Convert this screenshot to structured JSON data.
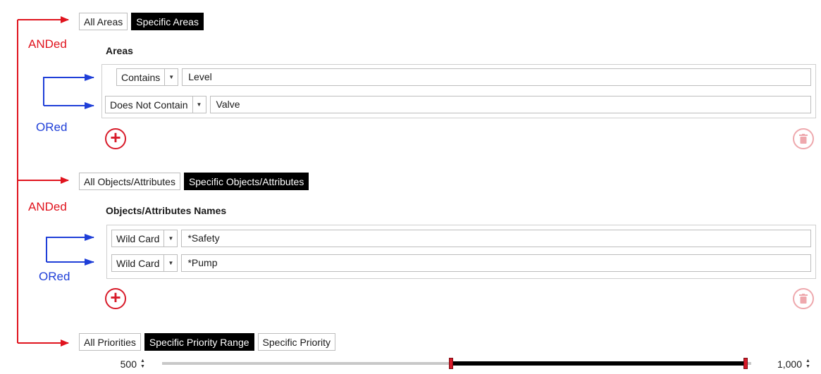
{
  "annotations": {
    "anded_1": "ANDed",
    "anded_2": "ANDed",
    "ored_1": "ORed",
    "ored_2": "ORed"
  },
  "areas": {
    "toggle": [
      {
        "label": "All Areas",
        "active": false
      },
      {
        "label": "Specific Areas",
        "active": true
      }
    ],
    "title": "Areas",
    "rows": [
      {
        "operator": "Contains",
        "value": "Level"
      },
      {
        "operator": "Does Not Contain",
        "value": "Valve"
      }
    ]
  },
  "objects": {
    "toggle": [
      {
        "label": "All Objects/Attributes",
        "active": false
      },
      {
        "label": "Specific Objects/Attributes",
        "active": true
      }
    ],
    "title": "Objects/Attributes Names",
    "rows": [
      {
        "operator": "Wild Card",
        "value": "*Safety"
      },
      {
        "operator": "Wild Card",
        "value": "*Pump"
      }
    ]
  },
  "priority": {
    "toggle": [
      {
        "label": "All Priorities",
        "active": false
      },
      {
        "label": "Specific Priority Range",
        "active": true
      },
      {
        "label": "Specific Priority",
        "active": false
      }
    ],
    "min_value": "500",
    "max_value": "1,000",
    "range_start_fraction": 0.49,
    "range_end_fraction": 0.99
  },
  "colors": {
    "and_arrow": "#e0141e",
    "or_arrow": "#1f3fd8",
    "add_button": "#d81b2a",
    "delete_button_disabled": "#eea8ad",
    "active_toggle": "#000000"
  },
  "icons": {
    "add": "plus-circle-icon",
    "delete": "trash-icon",
    "dropdown": "caret-down-icon",
    "spinner": "spin-updown-icon"
  }
}
